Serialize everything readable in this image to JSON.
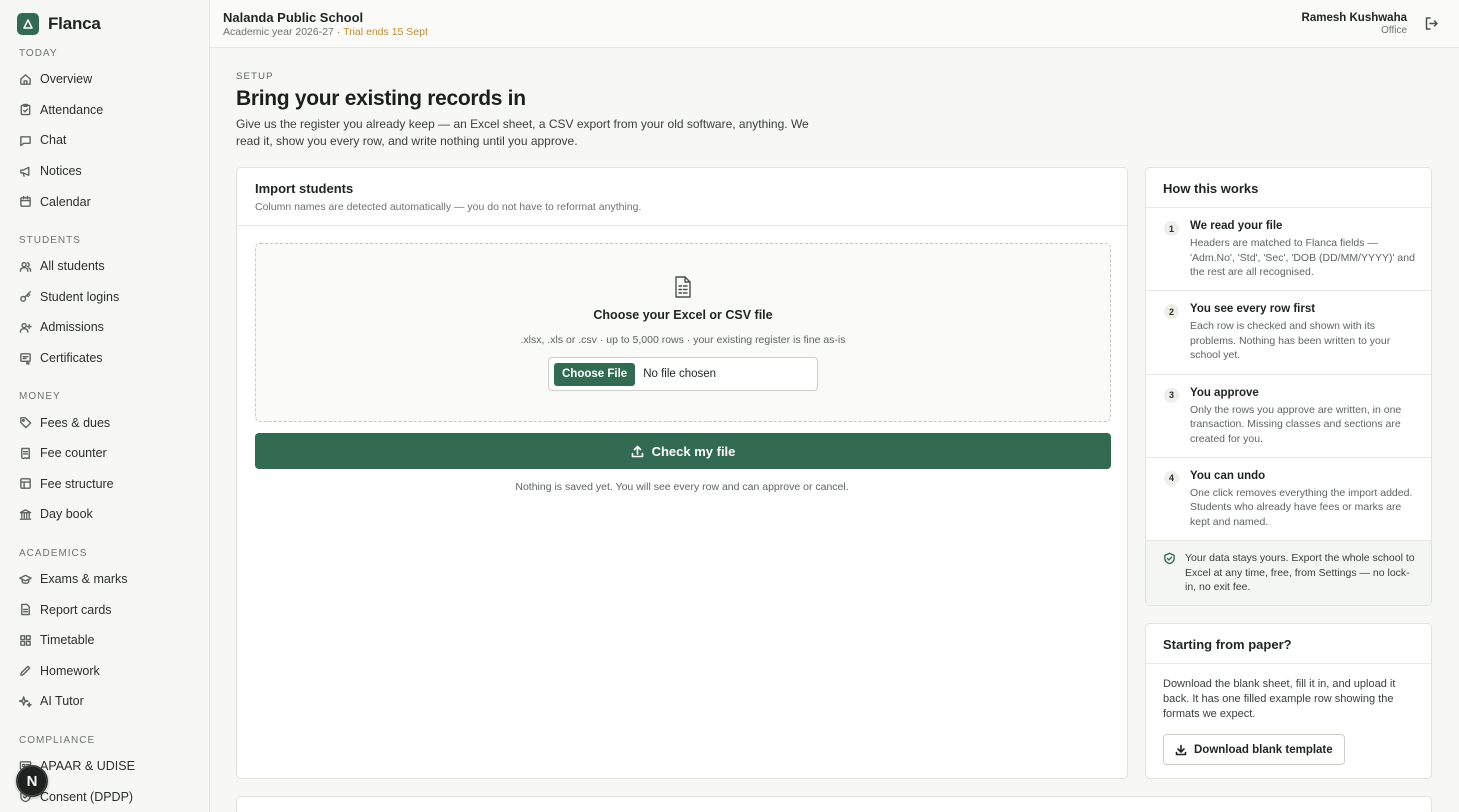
{
  "brand": {
    "name": "Flanca"
  },
  "sidebar": {
    "sections": [
      {
        "label": "TODAY",
        "items": [
          {
            "label": "Overview",
            "icon": "home-icon"
          },
          {
            "label": "Attendance",
            "icon": "clipboard-check-icon"
          },
          {
            "label": "Chat",
            "icon": "chat-icon"
          },
          {
            "label": "Notices",
            "icon": "megaphone-icon"
          },
          {
            "label": "Calendar",
            "icon": "calendar-icon"
          }
        ]
      },
      {
        "label": "STUDENTS",
        "items": [
          {
            "label": "All students",
            "icon": "users-icon"
          },
          {
            "label": "Student logins",
            "icon": "key-icon"
          },
          {
            "label": "Admissions",
            "icon": "user-plus-icon"
          },
          {
            "label": "Certificates",
            "icon": "certificate-icon"
          }
        ]
      },
      {
        "label": "MONEY",
        "items": [
          {
            "label": "Fees & dues",
            "icon": "tag-icon"
          },
          {
            "label": "Fee counter",
            "icon": "receipt-icon"
          },
          {
            "label": "Fee structure",
            "icon": "table-icon"
          },
          {
            "label": "Day book",
            "icon": "bank-icon"
          }
        ]
      },
      {
        "label": "ACADEMICS",
        "items": [
          {
            "label": "Exams & marks",
            "icon": "graduation-cap-icon"
          },
          {
            "label": "Report cards",
            "icon": "document-icon"
          },
          {
            "label": "Timetable",
            "icon": "grid-icon"
          },
          {
            "label": "Homework",
            "icon": "pencil-icon"
          },
          {
            "label": "AI Tutor",
            "icon": "sparkle-icon"
          }
        ]
      },
      {
        "label": "COMPLIANCE",
        "items": [
          {
            "label": "APAAR & UDISE",
            "icon": "id-card-icon"
          },
          {
            "label": "Consent (DPDP)",
            "icon": "shield-check-icon"
          }
        ]
      }
    ],
    "fab_label": "N"
  },
  "header": {
    "school_name": "Nalanda Public School",
    "academic_year": "Academic year 2026-27",
    "separator": " · ",
    "trial": "Trial ends 15 Sept",
    "user_name": "Ramesh Kushwaha",
    "user_role": "Office"
  },
  "page": {
    "eyebrow": "SETUP",
    "title": "Bring your existing records in",
    "description": "Give us the register you already keep — an Excel sheet, a CSV export from your old software, anything. We read it, show you every row, and write nothing until you approve."
  },
  "import_card": {
    "title": "Import students",
    "subtitle": "Column names are detected automatically — you do not have to reformat anything.",
    "dropzone_title": "Choose your Excel or CSV file",
    "dropzone_hint": ".xlsx, .xls or .csv · up to 5,000 rows · your existing register is fine as-is",
    "choose_label": "Choose File",
    "file_status": "No file chosen",
    "check_label": "Check my file",
    "note": "Nothing is saved yet. You will see every row and can approve or cancel."
  },
  "how_card": {
    "title": "How this works",
    "steps": [
      {
        "num": "1",
        "title": "We read your file",
        "desc": "Headers are matched to Flanca fields — 'Adm.No', 'Std', 'Sec', 'DOB (DD/MM/YYYY)' and the rest are all recognised."
      },
      {
        "num": "2",
        "title": "You see every row first",
        "desc": "Each row is checked and shown with its problems. Nothing has been written to your school yet."
      },
      {
        "num": "3",
        "title": "You approve",
        "desc": "Only the rows you approve are written, in one transaction. Missing classes and sections are created for you."
      },
      {
        "num": "4",
        "title": "You can undo",
        "desc": "One click removes everything the import added. Students who already have fees or marks are kept and named."
      }
    ],
    "footer": "Your data stays yours. Export the whole school to Excel at any time, free, from Settings — no lock-in, no exit fee."
  },
  "paper_card": {
    "title": "Starting from paper?",
    "desc": "Download the blank sheet, fill it in, and upload it back. It has one filled example row showing the formats we expect.",
    "button_label": "Download blank template"
  },
  "colors": {
    "accent": "#336b52",
    "trial": "#c48b2e"
  }
}
